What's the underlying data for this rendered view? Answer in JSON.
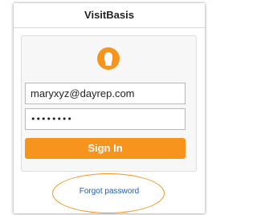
{
  "window": {
    "title": "VisitBasis"
  },
  "login": {
    "user_icon": "user-avatar-icon",
    "email_value": "maryxyz@dayrep.com",
    "password_mask": "••••••••",
    "sign_in_label": "Sign In"
  },
  "links": {
    "forgot_password": "Forgot password"
  },
  "colors": {
    "accent": "#f7941d",
    "link": "#1f5fb8"
  }
}
